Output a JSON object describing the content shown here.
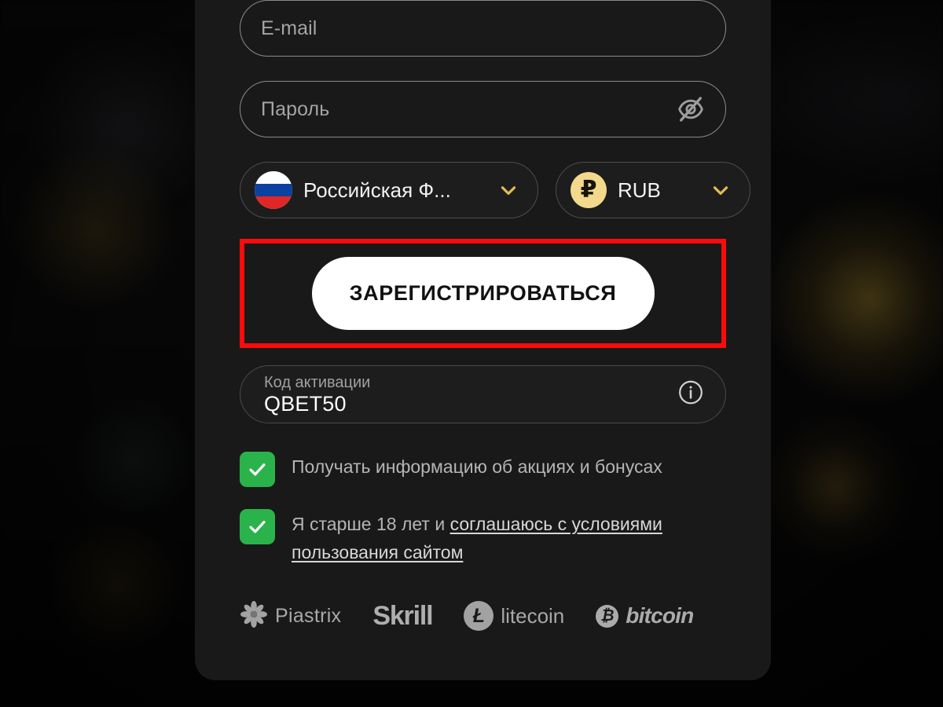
{
  "form": {
    "email": {
      "placeholder": "E-mail",
      "value": ""
    },
    "password": {
      "placeholder": "Пароль",
      "value": "",
      "toggle_icon": "eye-off-icon"
    },
    "country": {
      "label": "Российская Ф...",
      "flag_icon": "russia-flag-icon",
      "chevron_icon": "chevron-down-icon"
    },
    "currency": {
      "label": "RUB",
      "symbol": "₽",
      "coin_icon": "ruble-coin-icon",
      "chevron_icon": "chevron-down-icon"
    },
    "submit": {
      "label": "ЗАРЕГИСТРИРОВАТЬСЯ"
    },
    "promo": {
      "label": "Код активации",
      "value": "QBET50",
      "info_icon": "info-circle-icon"
    }
  },
  "consents": [
    {
      "checked": true,
      "check_icon": "checkmark-icon",
      "text": "Получать информацию об акциях и бонусах",
      "link_text": "",
      "link_tail": ""
    },
    {
      "checked": true,
      "check_icon": "checkmark-icon",
      "text": "Я старше 18 лет и ",
      "link_text": "соглашаюсь с условиями пользования сайтом",
      "link_tail": ""
    }
  ],
  "payments": [
    {
      "name": "Piastrix",
      "icon": "piastrix-flower-icon"
    },
    {
      "name": "Skrill",
      "icon": "skrill-wordmark-icon"
    },
    {
      "name": "litecoin",
      "icon": "litecoin-coin-icon",
      "symbol": "Ł"
    },
    {
      "name": "bitcoin",
      "icon": "bitcoin-coin-icon",
      "symbol": "₿"
    }
  ],
  "annotation": {
    "highlight_color": "#fb0b0b",
    "target": "register-button"
  },
  "colors": {
    "card_background": "#191919",
    "page_background": "#050505",
    "accent_gold": "#f2d98b",
    "checkbox_green": "#2ab34a",
    "button_background": "#ffffff",
    "placeholder_text": "#a4a4a4"
  }
}
